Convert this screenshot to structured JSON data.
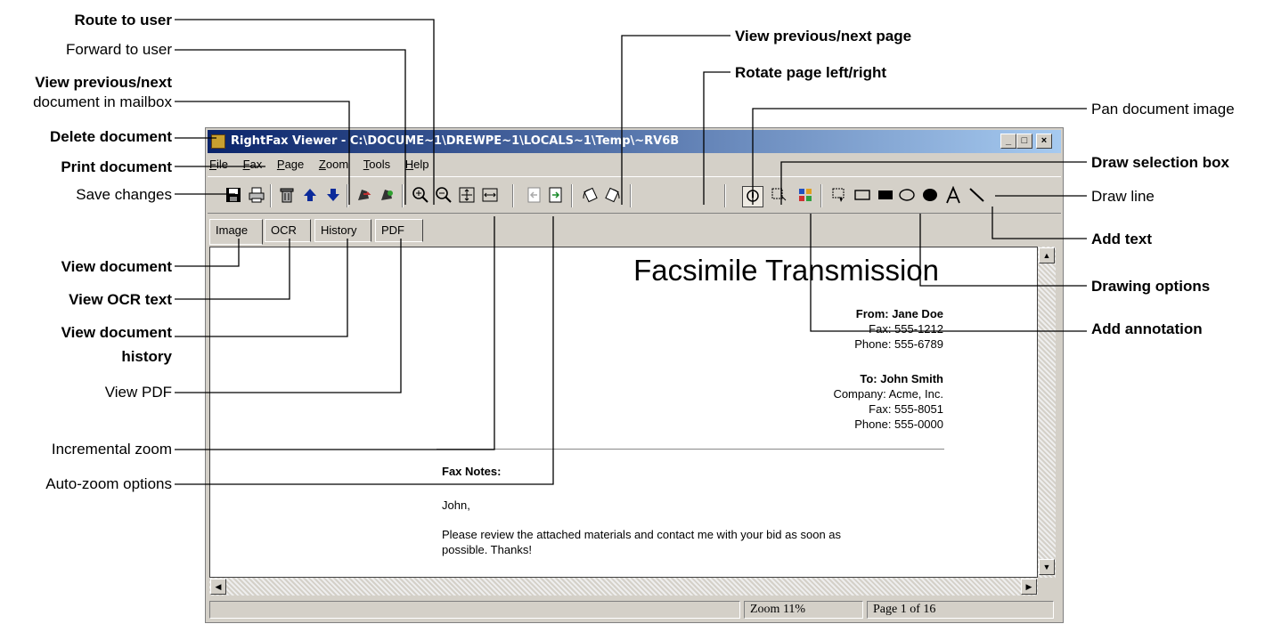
{
  "callouts": {
    "left": {
      "route_to_user": "Route to user",
      "forward_to_user": "Forward to user",
      "view_prev_next_doc_line1": "View previous/next",
      "view_prev_next_doc_line2": "document in mailbox",
      "delete_document": "Delete document",
      "print_document": "Print document",
      "save_changes": "Save changes",
      "view_document": "View document",
      "view_ocr_text": "View OCR text",
      "view_document_history_line1": "View document",
      "view_document_history_line2": "history",
      "view_pdf": "View PDF",
      "incremental_zoom": "Incremental zoom",
      "auto_zoom_options": "Auto-zoom options"
    },
    "top": {
      "view_prev_next_page": "View previous/next page",
      "rotate_page": "Rotate page left/right"
    },
    "right": {
      "pan_document_image": "Pan document image",
      "draw_selection_box": "Draw selection box",
      "draw_line": "Draw line",
      "add_text": "Add text",
      "drawing_options": "Drawing options",
      "add_annotation": "Add annotation"
    }
  },
  "window": {
    "title": "RightFax Viewer - C:\\DOCUME~1\\DREWPE~1\\LOCALS~1\\Temp\\~RV6B",
    "controls": {
      "minimize": "_",
      "maximize": "□",
      "close": "×"
    },
    "menu": [
      "File",
      "Fax",
      "Page",
      "Zoom",
      "Tools",
      "Help"
    ],
    "tabs": [
      "Image",
      "OCR",
      "History",
      "PDF"
    ],
    "active_tab": "Image",
    "toolbar_icons": [
      "save-icon",
      "print-icon",
      "delete-icon",
      "previous-document-icon",
      "next-document-icon",
      "forward-icon",
      "route-icon",
      "zoom-in-icon",
      "zoom-out-icon",
      "fit-page-icon",
      "fit-width-icon",
      "previous-page-icon",
      "next-page-icon",
      "rotate-left-icon",
      "rotate-right-icon",
      "pan-icon",
      "selection-box-icon",
      "annotation-icon",
      "drawing-options-icon",
      "rectangle-icon",
      "filled-rectangle-icon",
      "ellipse-icon",
      "filled-ellipse-icon",
      "text-icon",
      "line-icon"
    ],
    "status": {
      "zoom": "Zoom 11%",
      "page": "Page 1 of 16"
    }
  },
  "fax": {
    "title": "Facsimile Transmission",
    "from_line": "From: Jane Doe",
    "from_fax": "Fax: 555-1212",
    "from_phone": "Phone: 555-6789",
    "to_line": "To: John Smith",
    "to_company": "Company: Acme, Inc.",
    "to_fax": "Fax: 555-8051",
    "to_phone": "Phone: 555-0000",
    "notes_heading": "Fax Notes:",
    "greeting": "John,",
    "body_line1": "Please review the attached materials and contact me with your bid as soon as",
    "body_line2": "possible. Thanks!"
  },
  "colors": {
    "titlebar_start": "#0a246a",
    "titlebar_end": "#a6caf0",
    "chrome": "#d4d0c8",
    "arrow_blue": "#0b2a9a"
  }
}
